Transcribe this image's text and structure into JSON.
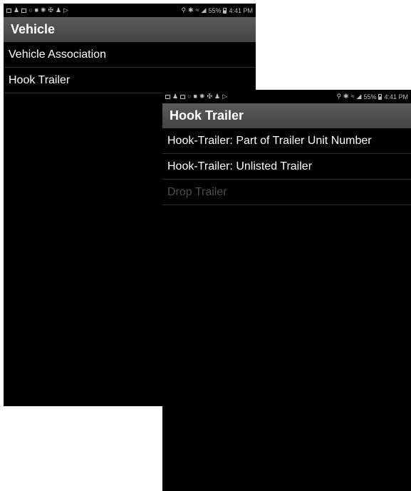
{
  "back_screen": {
    "status_bar": {
      "left_icons": [
        "image-icon",
        "person-icon",
        "photo-icon",
        "message-icon",
        "camera-icon",
        "gear-icon",
        "fan-icon",
        "person-icon",
        "play-icon"
      ],
      "right_icons": [
        "location-icon",
        "bluetooth-icon",
        "wifi-icon",
        "signal-icon"
      ],
      "battery_percent": "55%",
      "time": "4:41 PM"
    },
    "title": "Vehicle",
    "items": [
      {
        "label": "Vehicle Association"
      },
      {
        "label": "Hook Trailer"
      }
    ]
  },
  "front_screen": {
    "status_bar": {
      "left_icons": [
        "image-icon",
        "person-icon",
        "photo-icon",
        "message-icon",
        "camera-icon",
        "gear-icon",
        "fan-icon",
        "person-icon",
        "play-icon"
      ],
      "right_icons": [
        "location-icon",
        "bluetooth-icon",
        "wifi-icon",
        "signal-icon"
      ],
      "battery_percent": "55%",
      "time": "4:41 PM"
    },
    "title": "Hook Trailer",
    "items": [
      {
        "label": "Hook-Trailer: Part of Trailer Unit Number",
        "enabled": true
      },
      {
        "label": "Hook-Trailer: Unlisted Trailer",
        "enabled": true
      },
      {
        "label": "Drop Trailer",
        "enabled": false
      }
    ]
  },
  "colors": {
    "background": "#000000",
    "action_bar": "#4f4f4f",
    "text": "#ffffff",
    "disabled_text": "#4d4d4d",
    "divider": "#2e2e2e"
  }
}
